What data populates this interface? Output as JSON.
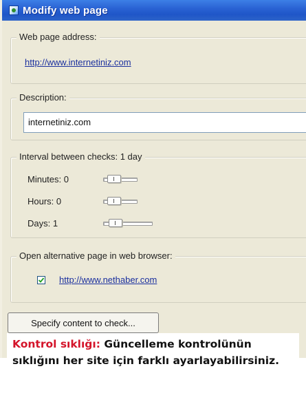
{
  "window": {
    "title": "Modify web page",
    "icon": "app-icon"
  },
  "address_group": {
    "label": "Web page address:",
    "url": "http://www.internetiniz.com"
  },
  "description_group": {
    "label": "Description:",
    "value": "internetiniz.com"
  },
  "interval_group": {
    "label": "Interval between checks: 1 day",
    "rows": [
      {
        "label": "Minutes: 0",
        "value": 0
      },
      {
        "label": "Hours: 0",
        "value": 0
      },
      {
        "label": "Days: 1",
        "value": 1
      }
    ]
  },
  "alt_page_group": {
    "label": "Open alternative page in web browser:",
    "checked": true,
    "url": "http://www.nethaber.com"
  },
  "specify_button": {
    "label": "Specify content to check..."
  },
  "caption": {
    "highlight": "Kontrol sıklığı:",
    "text": " Güncelleme kontrolünün sıklığını her site için farklı ayarlayabilirsiniz."
  },
  "colors": {
    "titlebar": "#2a63d4",
    "window_bg": "#ece9d8",
    "link": "#1a2f9e",
    "caption_accent": "#d4142a"
  }
}
